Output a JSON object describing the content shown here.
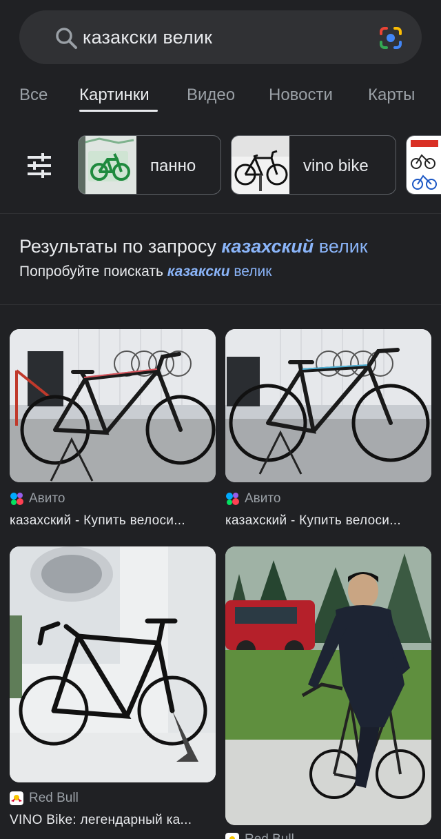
{
  "search": {
    "query": "казакски велик"
  },
  "tabs": [
    {
      "label": "Все"
    },
    {
      "label": "Картинки"
    },
    {
      "label": "Видео"
    },
    {
      "label": "Новости"
    },
    {
      "label": "Карты"
    }
  ],
  "chips": [
    {
      "label": "панно"
    },
    {
      "label": "vino bike"
    }
  ],
  "correction": {
    "prefix": "Результаты по запросу",
    "corrected_word": "казахский",
    "corrected_rest": "велик",
    "try_prefix": "Попробуйте поискать",
    "original_word": "казакски",
    "original_rest": "велик"
  },
  "results": [
    {
      "source": "Авито",
      "title": "казахский - Купить велоси..."
    },
    {
      "source": "Авито",
      "title": "казахский - Купить велоси..."
    },
    {
      "source": "Red Bull",
      "title": "VINO Bike: легендарный ка..."
    },
    {
      "source": "Red Bull",
      "title": ""
    }
  ],
  "colors": {
    "background": "#202124",
    "link_blue": "#8ab4f8",
    "text_primary": "#e8eaed",
    "text_secondary": "#9aa0a6"
  },
  "icons": [
    "search-icon",
    "google-lens-icon",
    "tune-icon",
    "avito-favicon",
    "redbull-favicon"
  ]
}
